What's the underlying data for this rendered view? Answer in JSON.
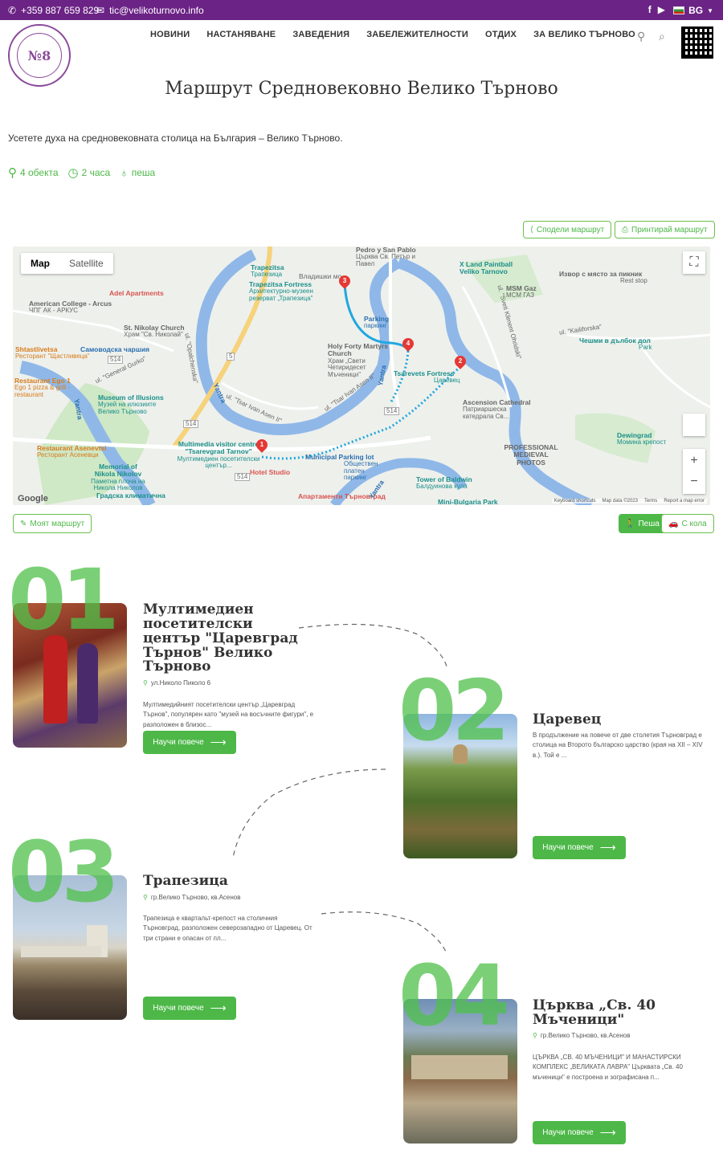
{
  "topbar": {
    "phone": "+359 887 659 829",
    "email": "tic@velikoturnovo.info",
    "lang": "BG"
  },
  "logo": {
    "text": "№8"
  },
  "nav": [
    "НОВИНИ",
    "НАСТАНЯВАНЕ",
    "ЗАВЕДЕНИЯ",
    "ЗАБЕЛЕЖИТЕЛНОСТИ",
    "ОТДИХ",
    "ЗА ВЕЛИКО ТЪРНОВО"
  ],
  "page": {
    "title": "Маршрут Средновековно Велико Търново",
    "intro": "Усетете духа на средновековната столица на България – Велико Търново.",
    "meta": {
      "objects": "4 обекта",
      "duration": "2 часа",
      "mode": "пеша"
    }
  },
  "actions": {
    "share": "Сподели маршрут",
    "print": "Принтирай маршрут",
    "my_route": "Моят маршрут",
    "walk": "Пеша",
    "car": "С кола"
  },
  "map": {
    "type_map": "Map",
    "type_satellite": "Satellite",
    "google": "Google",
    "footer": [
      "Keyboard shortcuts",
      "Map data ©2023",
      "Terms",
      "Report a map error"
    ],
    "labels": {
      "trapezitsa": "Trapezitsa",
      "trapezitsa_sub": "Трапезица",
      "vladishki": "Владишки мо...",
      "trap_fortress": "Trapezitsa Fortress",
      "trap_fortress_sub": "Архитектурно-музеен резерват „Трапезица\"",
      "pedro": "Pedro y San Pablo",
      "pedro_sub": "Църква Св. Петър и Павел",
      "xland": "X Land Paintball Veliko Tarnovo",
      "izvor": "Извор с място за пикник",
      "izvor_sub": "Rest stop",
      "adel": "Adel Apartments",
      "american": "American College - Arcus",
      "american_sub": "ЧПГ АК - АРКУС",
      "msm": "MSM Gaz",
      "msm_sub": "МСМ ГАЗ",
      "parking": "Parking",
      "parking_sub": "паркинг",
      "nikolay": "St. Nikolay Church",
      "nikolay_sub": "Храм \"Св. Николай\"",
      "shtastlivetsa": "Shtastlivetsa",
      "shtastlivetsa_sub": "Ресторант \"Щастливеца\"",
      "samovodska": "Самоводска чаршия",
      "martyrs": "Holy Forty Martyrs Church",
      "martyrs_sub": "Храм „Свети Четиридесет Мъченици\"",
      "chemishi": "Чешми в дълбок дол",
      "chemishi_sub": "Park",
      "ego": "Restaurant Ego 1",
      "ego_sub": "Ego 1 pizza & grill - restaurant",
      "tsarevets": "Tsarevets Fortress",
      "tsarevets_sub": "Царевец",
      "illusions": "Museum of Illusions",
      "illusions_sub": "Музей на илюзиите Велико Търново",
      "ascension": "Ascension Cathedral",
      "ascension_sub": "Патриаршеска катедрала Св...",
      "dewingrad": "Dewingrad",
      "dewingrad_sub": "Момина крепост",
      "asenevtsi": "Restaurant Asenevtsi",
      "asenevtsi_sub": "Ресторант Асеневци",
      "multimedia": "Multimedia visitor centre \"Tsarevgrad Tarnov\"",
      "multimedia_sub": "Мултимедиен посетителски център...",
      "municipal": "Municipal Parking lot",
      "municipal_sub": "Обществен платен паркинг",
      "professional": "PROFESSIONAL MEDIEVAL PHOTOS",
      "memorial": "Memorial of Nikola Nikolov",
      "memorial_sub": "Паметна плоча на Никола Николов",
      "hotel": "Hotel Studio",
      "baldwin": "Tower of Baldwin",
      "baldwin_sub": "Балдуинова кула",
      "apartamenti": "Апартаменти Търновград",
      "mini": "Mini-Bulgaria Park",
      "gradska": "Градска климатична",
      "yantra1": "Yantra",
      "yantra2": "Yantra",
      "yantra3": "Yantra",
      "yantra4": "Yantra",
      "ivan_asen": "ul. \"Tsar Ivan Asen II\"",
      "ivan_asen2": "ul. \"Tsar Ivan Asen II\"",
      "gurko": "ul. \"General Gurko\"",
      "opalchenska": "ul. \"Opalchenska\"",
      "kailiforska": "ul. \"Kailiforska\"",
      "kliment": "ul. \"Sveti Kliment Ohridski\"",
      "r514a": "514",
      "r514b": "514",
      "r514c": "514",
      "r514d": "514",
      "r5": "5"
    },
    "pins": [
      "1",
      "2",
      "3",
      "4"
    ]
  },
  "stops": [
    {
      "number": "01",
      "title": "Мултимедиен посетителски център \"Царевград Търнов\" Велико Търново",
      "address": "ул.Николо Пиколо 6",
      "desc": "Мултимедийният посетителски център „Царевград Търнов\", популярен като \"музей на восъчните фигури\", е разположен в близос...",
      "button": "Научи повече"
    },
    {
      "number": "02",
      "title": "Царевец",
      "address": "",
      "desc": "В продължение на повече от две столетия Търновград е столица на Второто българско царство (края на XII – XIV в.). Той е ...",
      "button": "Научи повече"
    },
    {
      "number": "03",
      "title": "Трапезица",
      "address": "гр.Велико Търново, кв.Асенов",
      "desc": "Трапезица е квартальт-крепост на столичния Търновград, разположен северозападно от Царевец. От три страни е опасан от пл...",
      "button": "Научи повече"
    },
    {
      "number": "04",
      "title": "Църква „Св. 40 Мъченици\"",
      "address": "гр.Велико Търново, кв.Асенов",
      "desc": "ЦЪРКВА „СВ. 40 МЪЧЕНИЦИ\" И МАНАСТИРСКИ КОМПЛЕКС „ВЕЛИКАТА ЛАВРА\" Църквата „Св. 40 мъченици\" е построена и зографисана п...",
      "button": "Научи повече"
    }
  ],
  "colors": {
    "purple": "#6b2385",
    "green": "#4db848",
    "number_green": "#4fc14a"
  }
}
